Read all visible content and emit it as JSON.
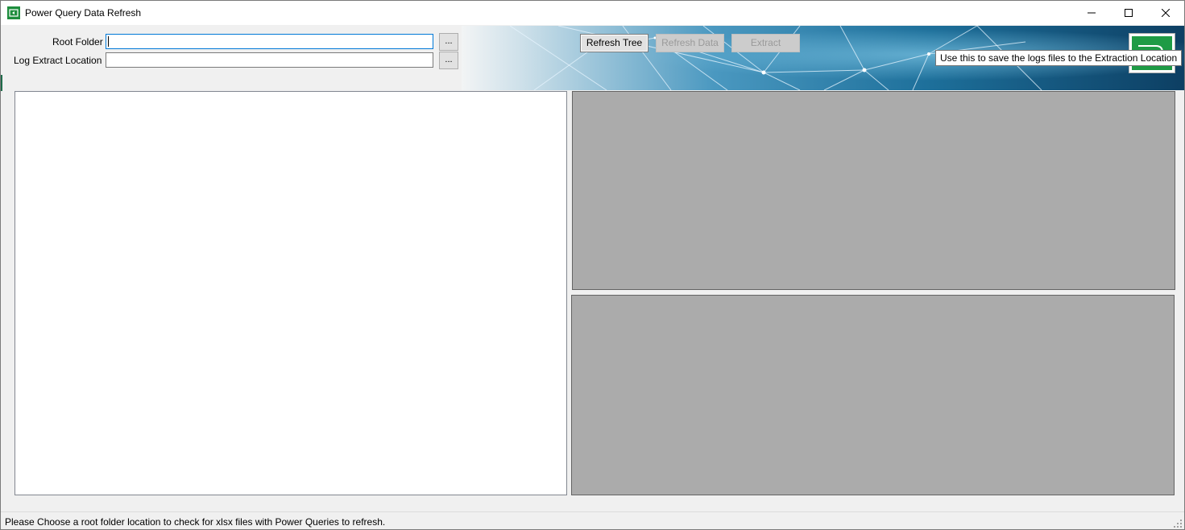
{
  "window": {
    "title": "Power Query Data Refresh",
    "icon": "power-query-icon",
    "controls": [
      "minimize-icon",
      "maximize-icon",
      "close-icon"
    ]
  },
  "form": {
    "root_folder": {
      "label": "Root Folder",
      "value": "",
      "browse_label": "..."
    },
    "log_extract": {
      "label": "Log Extract Location",
      "value": "",
      "browse_label": "..."
    }
  },
  "toolbar": {
    "refresh_tree": {
      "label": "Refresh Tree",
      "enabled": true
    },
    "refresh_data": {
      "label": "Refresh Data",
      "enabled": false
    },
    "extract": {
      "label": "Extract",
      "enabled": false
    },
    "save_logs": {
      "icon": "save-logs-icon"
    }
  },
  "tooltip": {
    "text": "Use this to save the logs files to the Extraction Location"
  },
  "status": {
    "text": "Please Choose a root folder location to check for xlsx files with Power Queries to refresh."
  },
  "colors": {
    "accent_green": "#1e9b45",
    "grid_bg": "#ababab",
    "banner_blue": "#1a6f9c"
  }
}
